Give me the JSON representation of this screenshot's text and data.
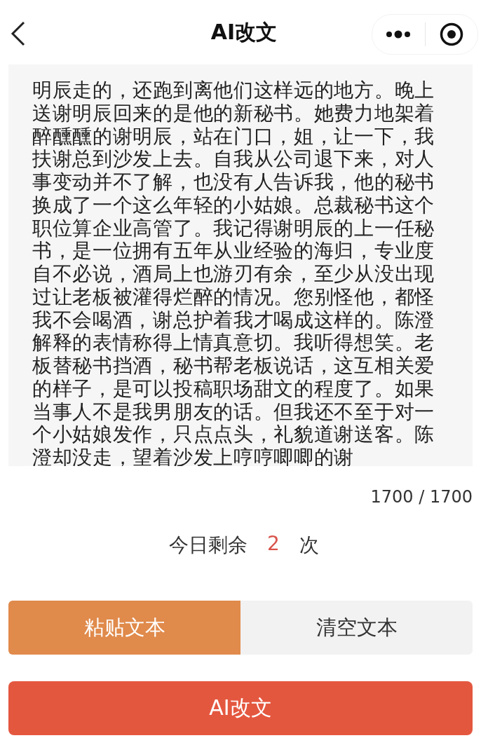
{
  "header": {
    "title": "AI改文"
  },
  "editor": {
    "text": "明辰走的，还跑到离他们这样远的地方。晚上送谢明辰回来的是他的新秘书。她费力地架着醉醺醺的谢明辰，站在门口，姐，让一下，我扶谢总到沙发上去。自我从公司退下来，对人事变动并不了解，也没有人告诉我，他的秘书换成了一个这么年轻的小姑娘。总裁秘书这个职位算企业高管了。我记得谢明辰的上一任秘书，是一位拥有五年从业经验的海归，专业度自不必说，酒局上也游刃有余，至少从没出现过让老板被灌得烂醉的情况。您别怪他，都怪我不会喝酒，谢总护着我才喝成这样的。陈澄解释的表情称得上情真意切。我听得想笑。老板替秘书挡酒，秘书帮老板说话，这互相关爱的样子，是可以投稿职场甜文的程度了。如果当事人不是我男朋友的话。但我还不至于对一个小姑娘发作，只点点头，礼貌道谢送客。陈澄却没走，望着沙发上哼哼唧唧的谢",
    "count": "1700 / 1700"
  },
  "quota": {
    "label": "今日剩余",
    "value": "2",
    "unit": "次"
  },
  "actions": [
    {
      "label": "粘贴文本",
      "kind": "primary"
    },
    {
      "label": "清空文本",
      "kind": "secondary"
    }
  ],
  "submit": {
    "label": "AI改文"
  }
}
